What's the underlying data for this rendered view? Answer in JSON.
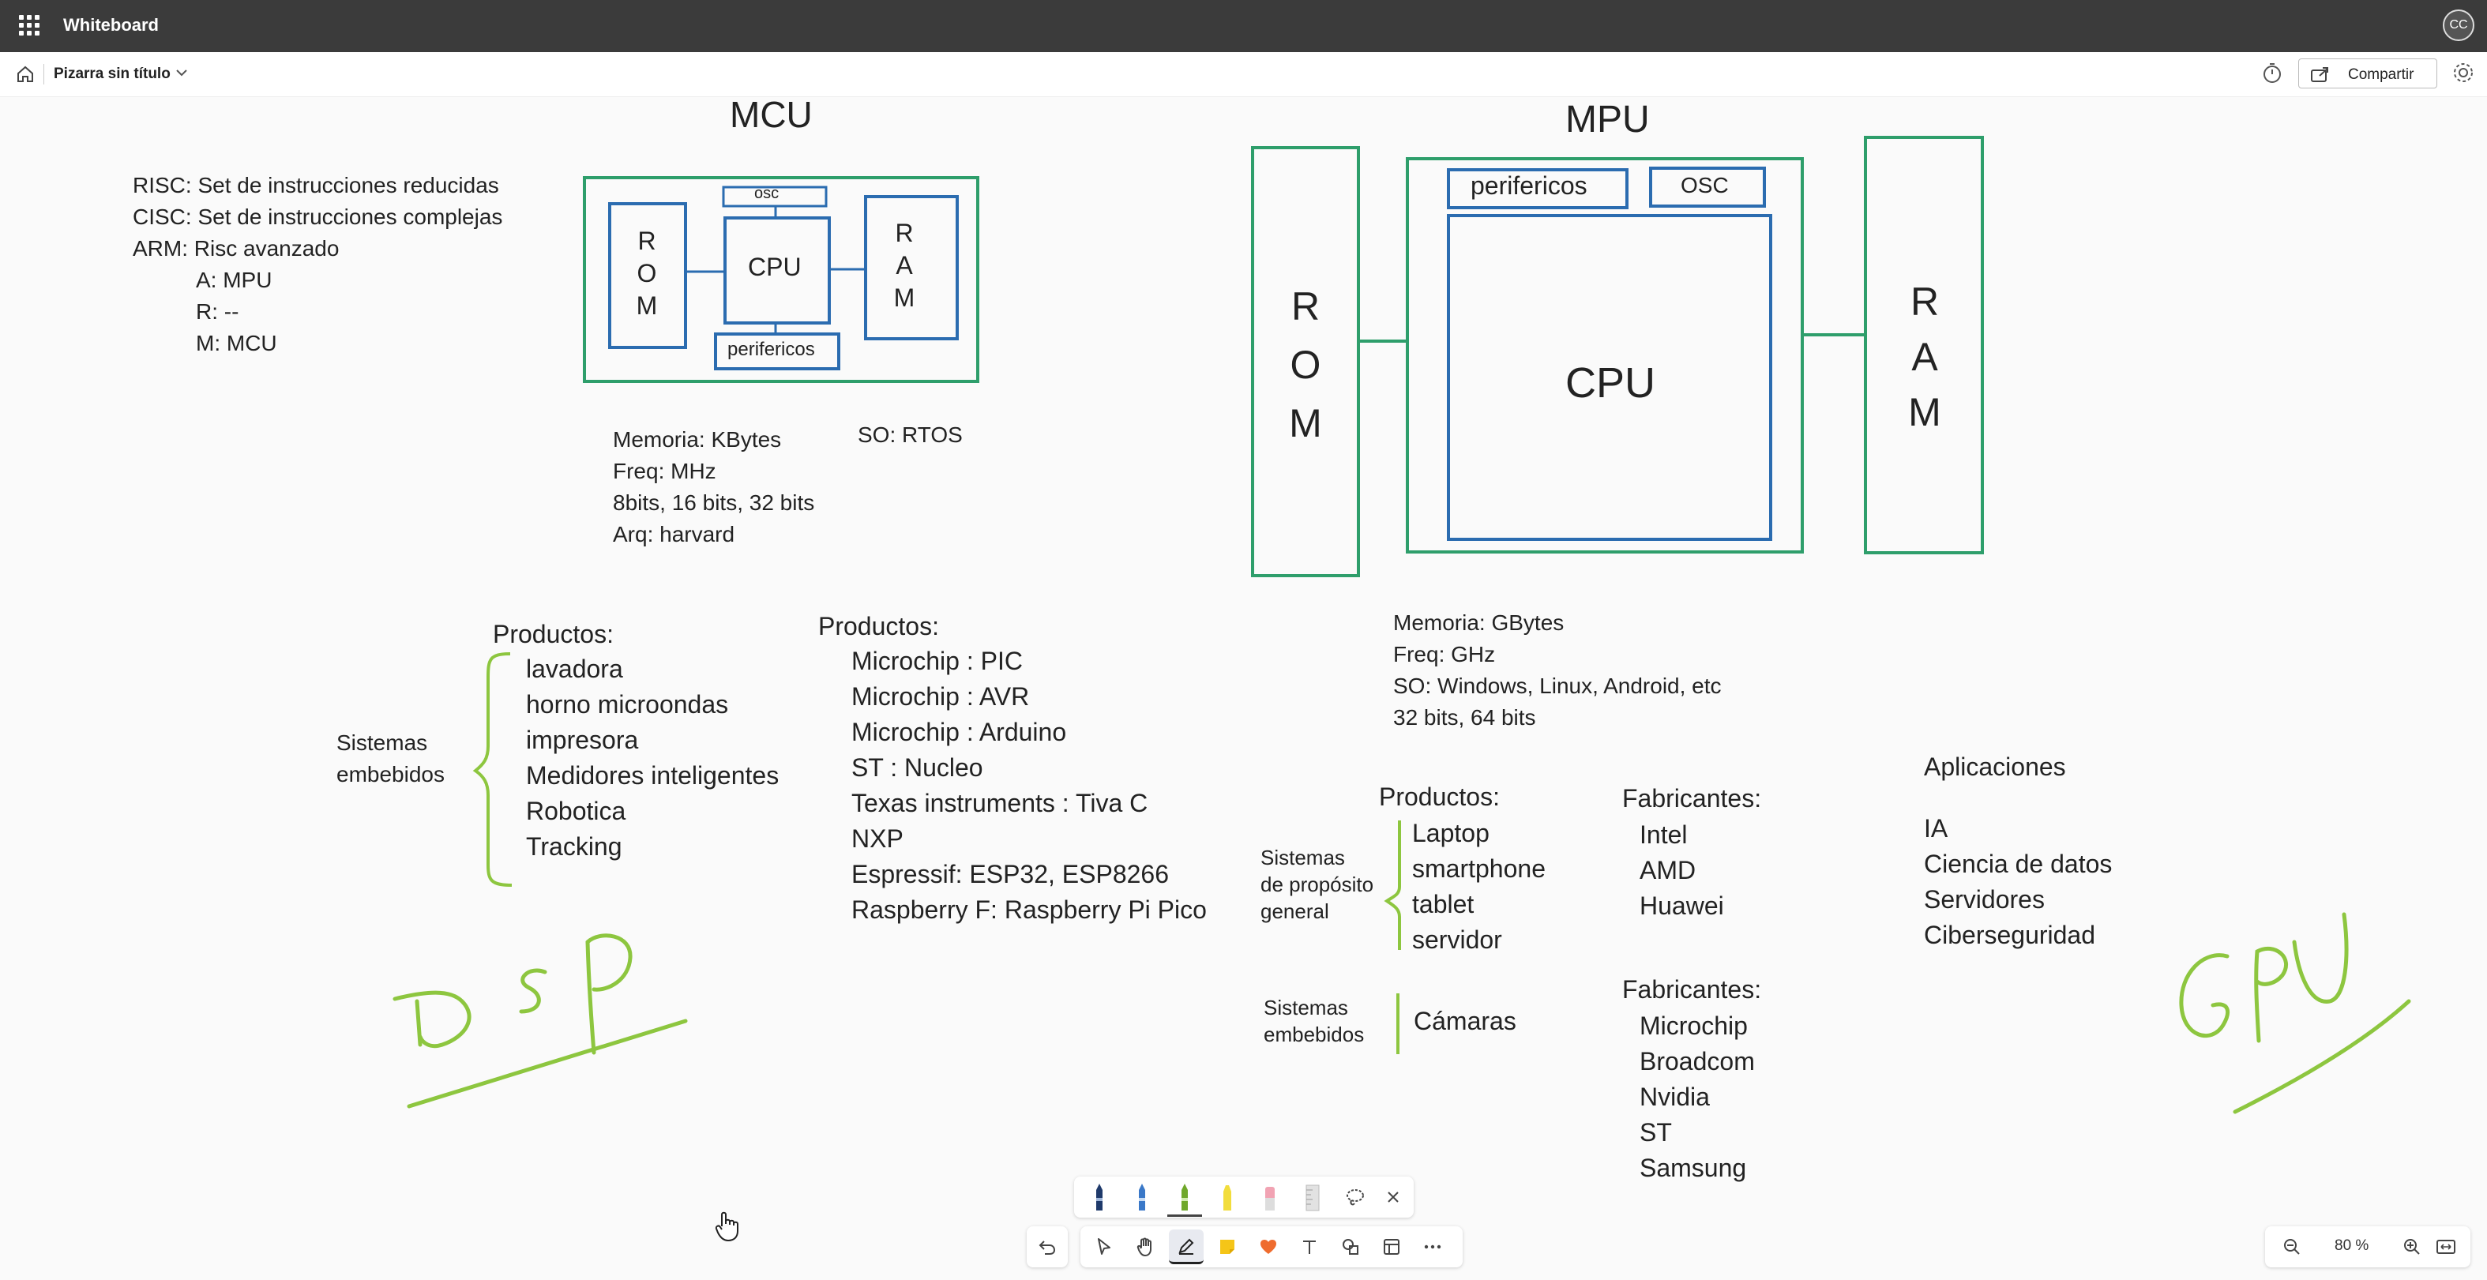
{
  "app": {
    "title": "Whiteboard",
    "avatar_initials": "CC"
  },
  "commandbar": {
    "board_name": "Pizarra sin título",
    "share_label": "Compartir"
  },
  "board": {
    "mcu": {
      "title": "MCU",
      "blocks": {
        "osc": "osc",
        "cpu": "CPU",
        "rom": [
          "R",
          "O",
          "M"
        ],
        "ram": [
          "R",
          "A",
          "M"
        ],
        "periph": "perifericos"
      },
      "specs": [
        "Memoria: KBytes",
        "Freq: MHz",
        "8bits, 16 bits, 32 bits",
        "Arq: harvard"
      ],
      "os": "SO: RTOS"
    },
    "isa_notes": [
      "RISC: Set de instrucciones reducidas",
      "CISC: Set de instrucciones complejas",
      "ARM: Risc avanzado",
      "A: MPU",
      "R: --",
      "M: MCU"
    ],
    "mpu": {
      "title": "MPU",
      "blocks": {
        "periph": "perifericos",
        "osc": "OSC",
        "cpu": "CPU",
        "rom": [
          "R",
          "O",
          "M"
        ],
        "ram": [
          "R",
          "A",
          "M"
        ]
      },
      "specs": [
        "Memoria: GBytes",
        "Freq: GHz",
        "SO: Windows, Linux, Android, etc",
        "32 bits, 64 bits"
      ]
    },
    "mcu_products": {
      "group_label": [
        "Sistemas",
        "embebidos"
      ],
      "title": "Productos:",
      "items": [
        "lavadora",
        "horno microondas",
        "impresora",
        "Medidores inteligentes",
        "Robotica",
        "Tracking"
      ]
    },
    "mcu_vendors": {
      "title": "Productos:",
      "items": [
        "Microchip : PIC",
        "Microchip : AVR",
        "Microchip : Arduino",
        "ST : Nucleo",
        "Texas instruments : Tiva C",
        "NXP",
        "Espressif: ESP32, ESP8266",
        "Raspberry F: Raspberry Pi Pico"
      ]
    },
    "mpu_products": {
      "group_label": [
        "Sistemas",
        "de propósito",
        "general"
      ],
      "title": "Productos:",
      "items": [
        "Laptop",
        "smartphone",
        "tablet",
        "servidor"
      ],
      "embedded_label": [
        "Sistemas",
        "embebidos"
      ],
      "embedded_items": [
        "Cámaras"
      ]
    },
    "mpu_vendors_1": {
      "title": "Fabricantes:",
      "items": [
        "Intel",
        "AMD",
        "Huawei"
      ]
    },
    "mpu_vendors_2": {
      "title": "Fabricantes:",
      "items": [
        "Microchip",
        "Broadcom",
        "Nvidia",
        "ST",
        "Samsung"
      ]
    },
    "applications": {
      "title": "Aplicaciones",
      "items": [
        "IA",
        "Ciencia de datos",
        "Servidores",
        "Ciberseguridad"
      ]
    },
    "handwriting": {
      "dsp": "DSP",
      "gpu": "GPU"
    }
  },
  "toolbar": {
    "pens": [
      "pen-blue-dark",
      "pen-blue-light",
      "pen-green",
      "highlighter-yellow",
      "eraser-pink",
      "ruler"
    ],
    "tools": [
      "undo",
      "select",
      "pan",
      "draw",
      "sticky-note",
      "reactions",
      "text",
      "shapes",
      "templates",
      "more"
    ]
  },
  "zoom": {
    "percent": "80 %"
  },
  "colors": {
    "title_bar": "#3b3b3b",
    "ink_green": "#8dc63f",
    "box_green": "#2e9e6b",
    "box_blue": "#2b6cb0"
  }
}
